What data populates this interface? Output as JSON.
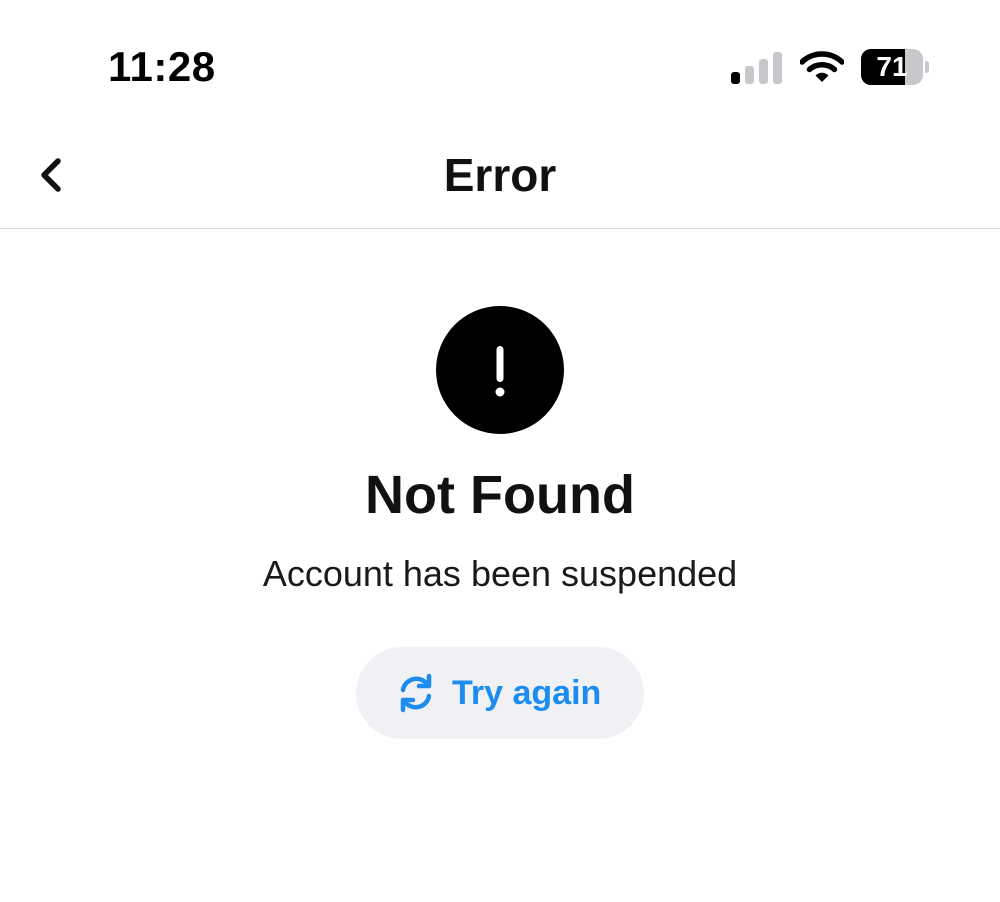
{
  "status_bar": {
    "time": "11:28",
    "battery_percent": "71",
    "battery_level": 0.71,
    "signal_bars_total": 4,
    "signal_bars_active": 1,
    "icons": [
      "cellular-signal-icon",
      "wifi-icon",
      "battery-icon"
    ]
  },
  "nav": {
    "title": "Error",
    "back_icon": "chevron-left-icon"
  },
  "error": {
    "icon": "exclamation-circle-icon",
    "title": "Not Found",
    "message": "Account has been suspended"
  },
  "retry": {
    "label": "Try again",
    "icon": "refresh-icon"
  },
  "colors": {
    "accent": "#1d8cf0",
    "button_bg": "#eff1f4",
    "text": "#111111",
    "divider": "#dcdcdc"
  }
}
